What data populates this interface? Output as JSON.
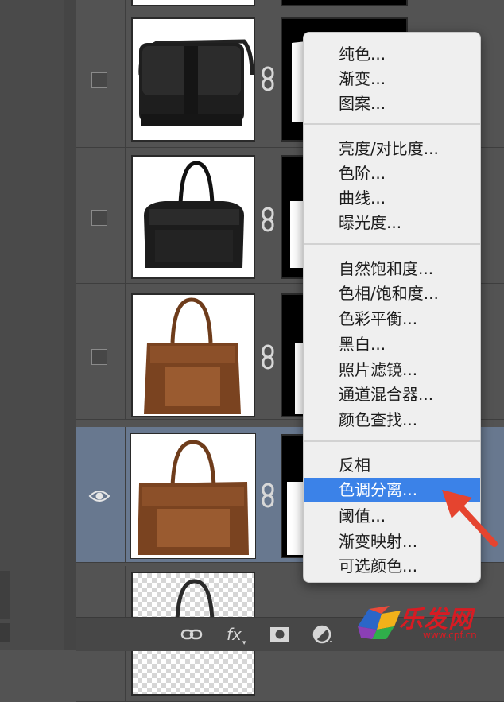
{
  "context_menu": {
    "groups": [
      [
        "纯色...",
        "渐变...",
        "图案..."
      ],
      [
        "亮度/对比度...",
        "色阶...",
        "曲线...",
        "曝光度..."
      ],
      [
        "自然饱和度...",
        "色相/饱和度...",
        "色彩平衡...",
        "黑白...",
        "照片滤镜...",
        "通道混合器...",
        "颜色查找..."
      ],
      [
        "反相",
        "色调分离...",
        "阈值...",
        "渐变映射...",
        "可选颜色..."
      ]
    ],
    "highlighted": "色调分离..."
  },
  "layers": [
    {
      "visible": false,
      "bag": "black-messenger-bag"
    },
    {
      "visible": false,
      "bag": "black-duffel-bag"
    },
    {
      "visible": false,
      "bag": "brown-tote-bag"
    },
    {
      "visible": true,
      "selected": true,
      "bag": "brown-tote-bag"
    },
    {
      "visible": false,
      "bag": "partial-bag"
    }
  ],
  "bottom_toolbar": {
    "fx_label": "fx"
  },
  "watermark": {
    "brand": "乐发网",
    "url": "www.cpf.cn"
  },
  "colors": {
    "panel_bg": "#535353",
    "selected_row": "#68788f",
    "menu_bg": "#efefef",
    "menu_highlight": "#3b82e8",
    "arrow": "#e5442f"
  }
}
